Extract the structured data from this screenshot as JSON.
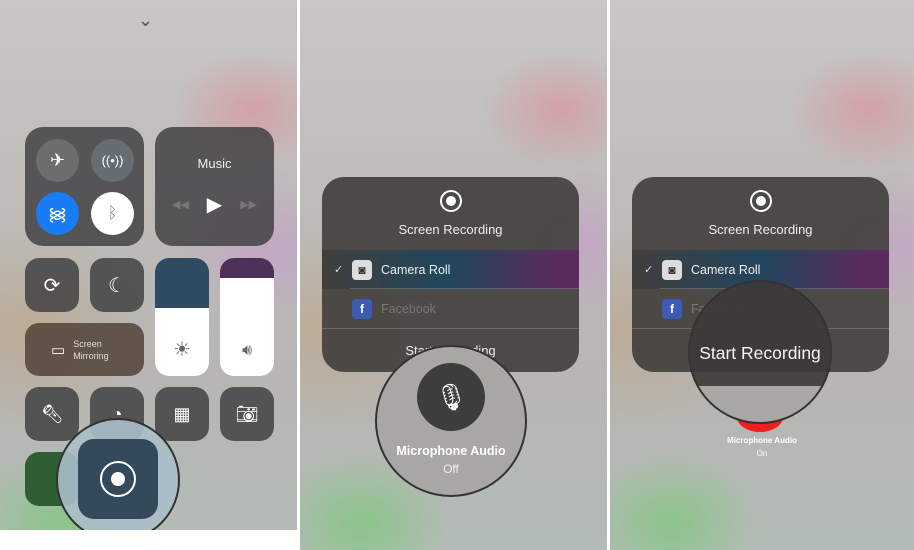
{
  "panel1": {
    "music_label": "Music",
    "screen_mirroring_label": "Screen\nMirroring",
    "controls": [
      "airplane-mode",
      "cellular-data",
      "wifi",
      "bluetooth",
      "rotation-lock",
      "do-not-disturb",
      "flashlight",
      "timer",
      "calculator",
      "camera",
      "screen-recording"
    ],
    "brightness_level": 0.58,
    "volume_level": 0.83,
    "colors": {
      "wifi_active": "#1a7cf5",
      "bluetooth_active": "#ffffff"
    }
  },
  "panel2": {
    "title": "Screen Recording",
    "destinations": [
      {
        "label": "Camera Roll",
        "selected": true
      },
      {
        "label": "Facebook",
        "selected": false
      }
    ],
    "start_label": "Start Recording",
    "mic_label": "Microphone Audio",
    "mic_state": "Off"
  },
  "panel3": {
    "title": "Screen Recording",
    "destinations": [
      {
        "label": "Camera Roll",
        "selected": true
      },
      {
        "label": "Facebook",
        "selected": false
      }
    ],
    "start_label": "Start Recording",
    "mic_label": "Microphone Audio",
    "mic_state": "On",
    "record_color": "#f21d1d"
  }
}
